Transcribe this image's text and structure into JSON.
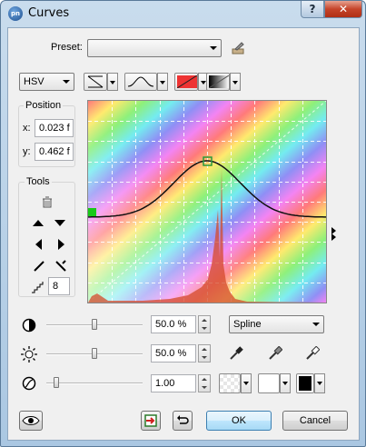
{
  "window": {
    "title": "Curves",
    "help_label": "?",
    "close_label": "✕",
    "app_icon": "app-logo-icon"
  },
  "preset": {
    "label": "Preset:",
    "value": ""
  },
  "mode": {
    "value": "HSV"
  },
  "position": {
    "title": "Position",
    "x_label": "x:",
    "x_value": "0.023 f",
    "y_label": "y:",
    "y_value": "0.462 f"
  },
  "tools": {
    "title": "Tools",
    "point_count": "8"
  },
  "contrast": {
    "value": "50.0 %",
    "slider_level": 0.5
  },
  "brightness": {
    "value": "50.0 %",
    "slider_level": 0.5
  },
  "gamma": {
    "value": "1.00",
    "slider_level": 0.1
  },
  "interpolation": {
    "value": "Spline"
  },
  "footer": {
    "ok_label": "OK",
    "cancel_label": "Cancel"
  },
  "colors": {
    "curve_point": "#19c919",
    "curve_point_selected": "#2a9a3a",
    "histogram": "#d44a2a",
    "curve": "#111111"
  }
}
